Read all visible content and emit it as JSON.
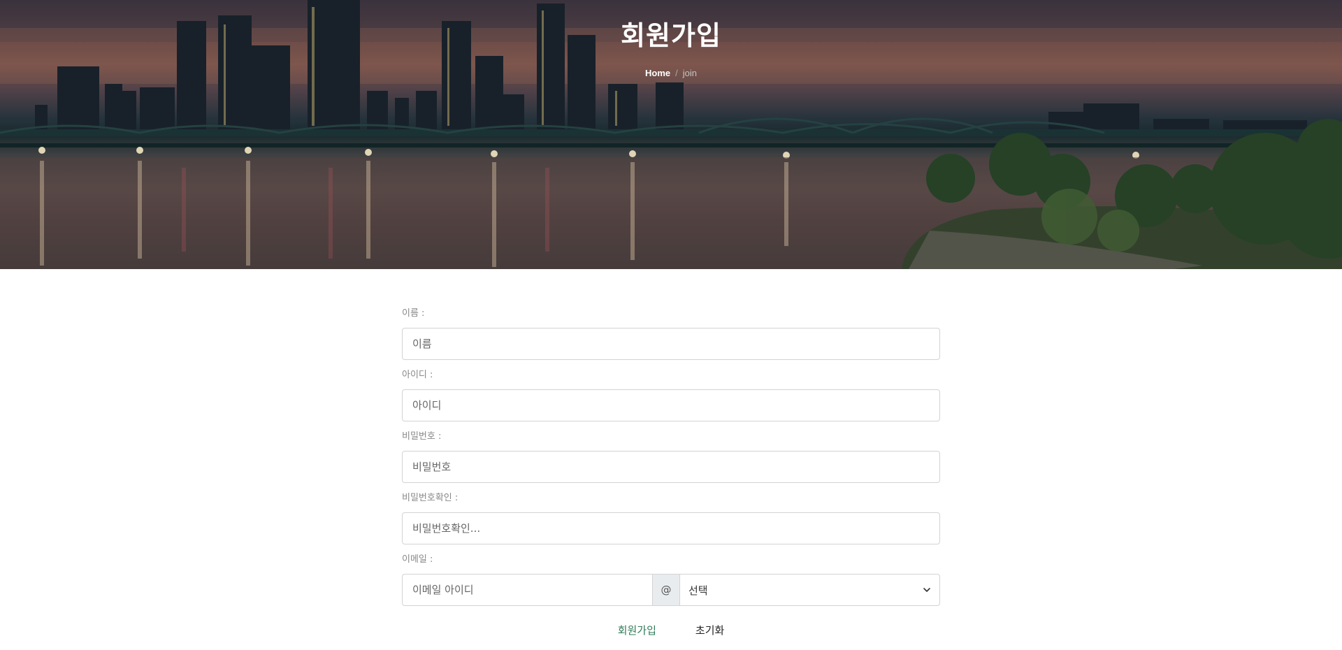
{
  "header": {
    "title": "회원가입",
    "breadcrumb": {
      "home": "Home",
      "separator": "/",
      "current": "join"
    }
  },
  "form": {
    "name": {
      "label": "이름 :",
      "placeholder": "이름"
    },
    "userid": {
      "label": "아이디 :",
      "placeholder": "아이디"
    },
    "password": {
      "label": "비밀번호 :",
      "placeholder": "비밀번호"
    },
    "password_confirm": {
      "label": "비밀번호확인 :",
      "placeholder": "비밀번호확인..."
    },
    "email": {
      "label": "이메일 :",
      "id_placeholder": "이메일 아이디",
      "at_symbol": "@",
      "domain_selected": "선택"
    }
  },
  "actions": {
    "join_label": "회원가입",
    "reset_label": "초기화"
  },
  "colors": {
    "join_button": "#2e7a57",
    "reset_button": "#222222"
  },
  "icons": {
    "domain_dropdown": "chevron-down-icon"
  }
}
